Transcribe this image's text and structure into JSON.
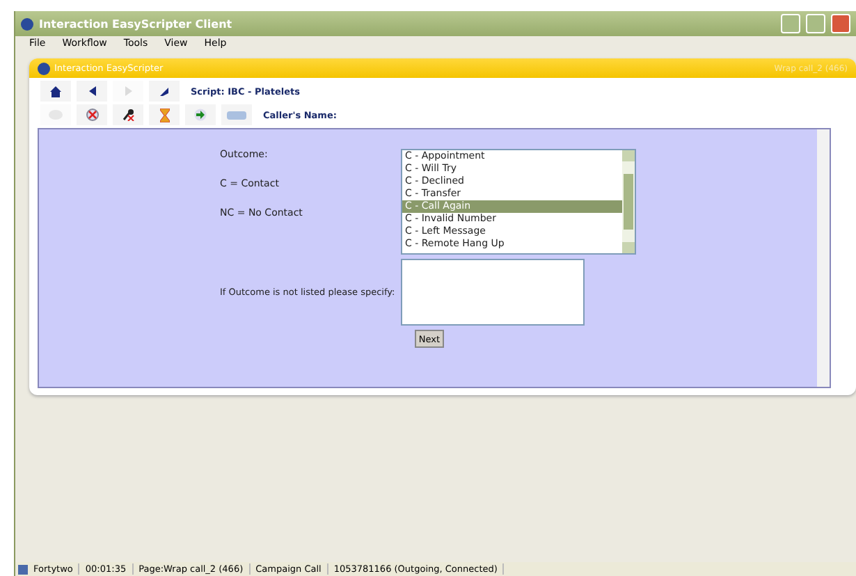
{
  "window": {
    "title": "Interaction EasyScripter Client"
  },
  "menu": [
    "File",
    "Workflow",
    "Tools",
    "View",
    "Help"
  ],
  "panel": {
    "title": "Interaction EasyScripter",
    "page_label": "Wrap call_2 (466)"
  },
  "script_label": "Script: IBC - Platelets",
  "caller_label": "Caller's Name:",
  "nav_buttons": [
    {
      "kind": "home",
      "disabled": false
    },
    {
      "kind": "back",
      "disabled": false
    },
    {
      "kind": "forward",
      "disabled": true
    },
    {
      "kind": "refresh",
      "disabled": false
    }
  ],
  "tool_buttons": [
    {
      "kind": "chat",
      "disabled": true
    },
    {
      "kind": "cancel",
      "disabled": false
    },
    {
      "kind": "mic",
      "disabled": false
    },
    {
      "kind": "hourglass",
      "disabled": false
    },
    {
      "kind": "transfer",
      "disabled": false
    },
    {
      "kind": "phone",
      "disabled": false
    }
  ],
  "form": {
    "labels": [
      "Outcome:",
      "C = Contact",
      "NC = No Contact"
    ],
    "outcomes": [
      {
        "label": "C - Appointment",
        "selected": false
      },
      {
        "label": "C - Will Try",
        "selected": false
      },
      {
        "label": "C - Declined",
        "selected": false
      },
      {
        "label": "C - Transfer",
        "selected": false
      },
      {
        "label": "C - Call Again",
        "selected": true
      },
      {
        "label": "C - Invalid Number",
        "selected": false
      },
      {
        "label": "C - Left Message",
        "selected": false
      },
      {
        "label": "C - Remote Hang Up",
        "selected": false
      }
    ],
    "specify_label": "If Outcome is not listed please specify:",
    "next_button": "Next"
  },
  "status_bar": [
    "Fortytwo",
    "00:01:35",
    "Page:Wrap call_2 (466)",
    "Campaign Call",
    "1053781166 (Outgoing, Connected)"
  ]
}
